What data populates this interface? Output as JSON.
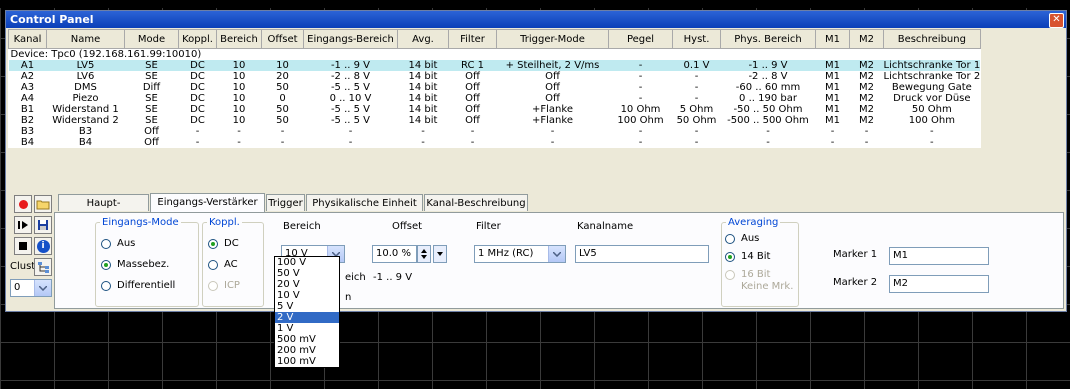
{
  "window": {
    "title": "Control Panel",
    "close_icon": "close-icon"
  },
  "table": {
    "columns": [
      "Kanal",
      "Name",
      "Mode",
      "Koppl.",
      "Bereich",
      "Offset",
      "Eingangs-Bereich",
      "Avg.",
      "Filter",
      "Trigger-Mode",
      "Pegel",
      "Hyst.",
      "Phys. Bereich",
      "M1",
      "M2",
      "Beschreibung"
    ],
    "device_row": "Device:  Tpc0  (192.168.161.99:10010)",
    "rows": [
      [
        "A1",
        "LV5",
        "SE",
        "DC",
        "10",
        "10",
        "-1 .. 9 V",
        "14 bit",
        "RC 1",
        "+ Steilheit, 2  V/ms",
        "-",
        "0.1 V",
        "-1 .. 9  V",
        "M1",
        "M2",
        "Lichtschranke Tor 1"
      ],
      [
        "A2",
        "LV6",
        "SE",
        "DC",
        "10",
        "20",
        "-2 .. 8 V",
        "14 bit",
        "Off",
        "Off",
        "-",
        "-",
        "-2 .. 8  V",
        "M1",
        "M2",
        "Lichtschranke Tor 2"
      ],
      [
        "A3",
        "DMS",
        "Diff",
        "DC",
        "10",
        "50",
        "-5 .. 5 V",
        "14 bit",
        "Off",
        "Off",
        "-",
        "-",
        "-60 .. 60  mm",
        "M1",
        "M2",
        "Bewegung Gate"
      ],
      [
        "A4",
        "Piezo",
        "SE",
        "DC",
        "10",
        "0",
        "0 .. 10 V",
        "14 bit",
        "Off",
        "Off",
        "-",
        "-",
        "0 .. 190  bar",
        "M1",
        "M2",
        "Druck vor Düse"
      ],
      [
        "B1",
        "Widerstand 1",
        "SE",
        "DC",
        "10",
        "50",
        "-5 .. 5 V",
        "14 bit",
        "Off",
        "+Flanke",
        "10 Ohm",
        "5 Ohm",
        "-50 .. 50  Ohm",
        "M1",
        "M2",
        "50 Ohm"
      ],
      [
        "B2",
        "Widerstand 2",
        "SE",
        "DC",
        "10",
        "50",
        "-5 .. 5 V",
        "14 bit",
        "Off",
        "+Flanke",
        "100 Ohm",
        "50 Ohm",
        "-500 .. 500  Ohm",
        "M1",
        "M2",
        "100 Ohm"
      ],
      [
        "B3",
        "B3",
        "Off",
        "-",
        "-",
        "-",
        "-",
        "-",
        "-",
        "-",
        "-",
        "-",
        "-",
        "-",
        "-",
        "-"
      ],
      [
        "B4",
        "B4",
        "Off",
        "-",
        "-",
        "-",
        "-",
        "-",
        "-",
        "-",
        "-",
        "-",
        "-",
        "-",
        "-",
        "-"
      ]
    ],
    "selected_row": 0
  },
  "tabs": [
    "Haupt-Einstellungen",
    "Eingangs-Verstärker",
    "Trigger",
    "Physikalische Einheit",
    "Kanal-Beschreibung"
  ],
  "active_tab": 1,
  "cluster": {
    "label": "Cluster",
    "value": "0"
  },
  "eingangs_mode": {
    "legend": "Eingangs-Mode",
    "options": [
      "Aus",
      "Massebez.",
      "Differentiell"
    ],
    "selected": "Massebez."
  },
  "koppl": {
    "legend": "Koppl.",
    "options": [
      "DC",
      "AC",
      "ICP"
    ],
    "selected": "DC"
  },
  "bereich": {
    "label": "Bereich",
    "value": "10 V",
    "options": [
      "100 V",
      "50 V",
      "20 V",
      "10 V",
      "5 V",
      "2 V",
      "1 V",
      "500 mV",
      "200 mV",
      "100 mV"
    ],
    "highlighted": "2 V"
  },
  "offset": {
    "label": "Offset",
    "value": "10.0 %"
  },
  "eingangsbereich_partial": {
    "label": "eich",
    "value": "-1 .. 9 V",
    "trailing": "n"
  },
  "filter": {
    "label": "Filter",
    "value": "1 MHz (RC)"
  },
  "kanalname": {
    "label": "Kanalname",
    "value": "LV5"
  },
  "averaging": {
    "legend": "Averaging",
    "options": [
      "Aus",
      "14 Bit",
      "16 Bit"
    ],
    "selected": "14 Bit",
    "note": "Keine Mrk."
  },
  "marker1": {
    "label": "Marker 1",
    "value": "M1"
  },
  "marker2": {
    "label": "Marker 2",
    "value": "M2"
  },
  "colors": {
    "title_bar": "#0a3fb8",
    "selected_row": "#bfeaf0",
    "record": "#e81b1b",
    "info": "#1450c8"
  }
}
